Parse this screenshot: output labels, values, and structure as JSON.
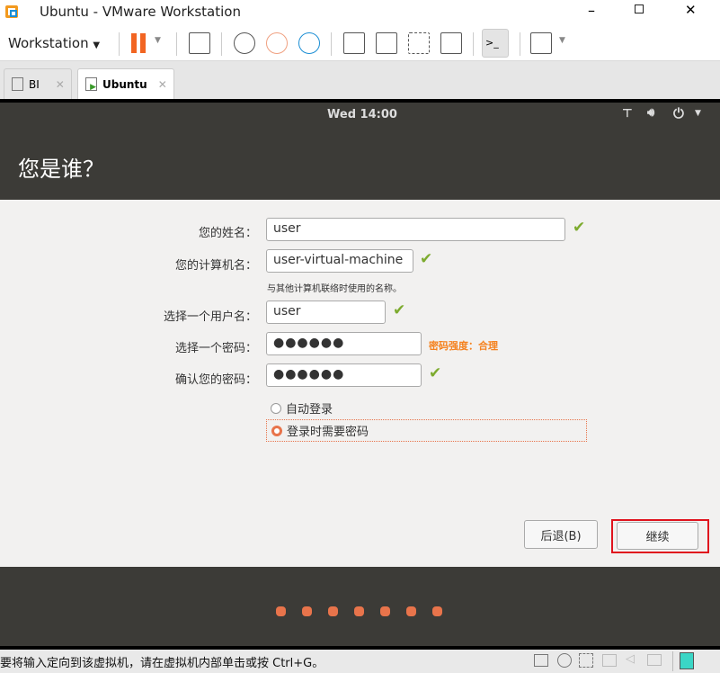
{
  "window": {
    "title": "Ubuntu - VMware Workstation"
  },
  "toolbar": {
    "menu_label": "Workstation"
  },
  "tabs": [
    {
      "label": "BI"
    },
    {
      "label": "Ubuntu"
    }
  ],
  "vm": {
    "clock": "Wed 14:00",
    "page_title": "您是谁？",
    "form": {
      "name_label": "您的姓名：",
      "name_value": "user",
      "computer_label": "您的计算机名：",
      "computer_value": "user-virtual-machine",
      "computer_hint": "与其他计算机联络时使用的名称。",
      "username_label": "选择一个用户名：",
      "username_value": "user",
      "password_label": "选择一个密码：",
      "password_value": "●●●●●●",
      "strength": "密码强度：合理",
      "confirm_label": "确认您的密码：",
      "confirm_value": "●●●●●●",
      "auto_login": "自动登录",
      "require_password": "登录时需要密码"
    },
    "back_button": "后退(B)",
    "continue_button": "继续",
    "progress_dots": 7,
    "accent": "#e8744b"
  },
  "statusbar": {
    "message": "要将输入定向到该虚拟机，请在虚拟机内部单击或按 Ctrl+G。"
  }
}
